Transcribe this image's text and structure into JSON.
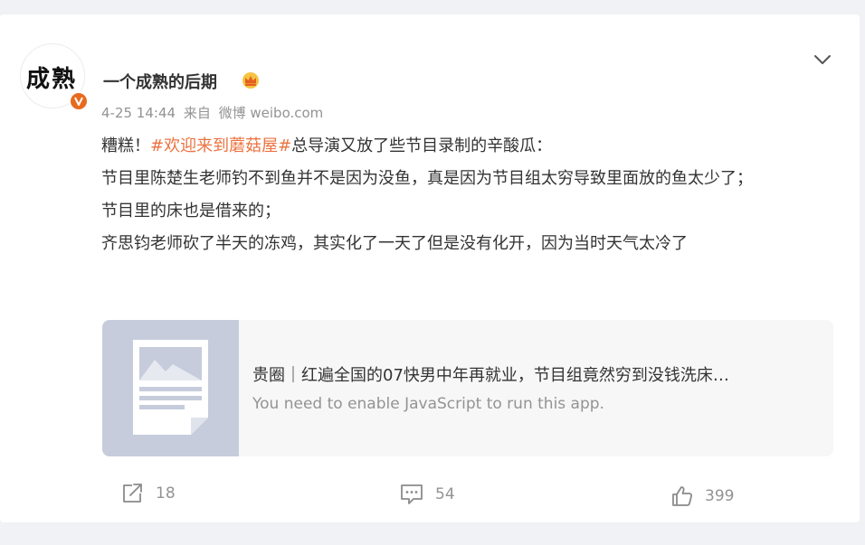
{
  "user": {
    "avatar_text": "成熟",
    "name": "一个成熟的后期",
    "crown_icon": "crown-icon",
    "verified_icon": "verified-v-icon"
  },
  "post": {
    "date": "4-25 14:44",
    "source_prefix": "来自",
    "source_name": "微博 weibo.com",
    "lines": {
      "l1_prefix": "糟糕！",
      "l1_topic": "#欢迎来到蘑菇屋#",
      "l1_suffix": "总导演又放了些节目录制的辛酸瓜：",
      "l2": "节目里陈楚生老师钓不到鱼并不是因为没鱼，真是因为节目组太穷导致里面放的鱼太少了；",
      "l3": "节目里的床也是借来的；",
      "l4": "齐思钧老师砍了半天的冻鸡，其实化了一天了但是没有化开，因为当时天气太冷了"
    }
  },
  "link_card": {
    "title": "贵圈｜红遍全国的07快男中年再就业，节目组竟然穷到没钱洗床…",
    "description": "You need to enable JavaScript to run this app."
  },
  "actions": {
    "repost_count": "18",
    "comment_count": "54",
    "like_count": "399"
  },
  "colors": {
    "accent": "#eb7340",
    "verified": "#e86a1e",
    "muted": "#939393"
  }
}
